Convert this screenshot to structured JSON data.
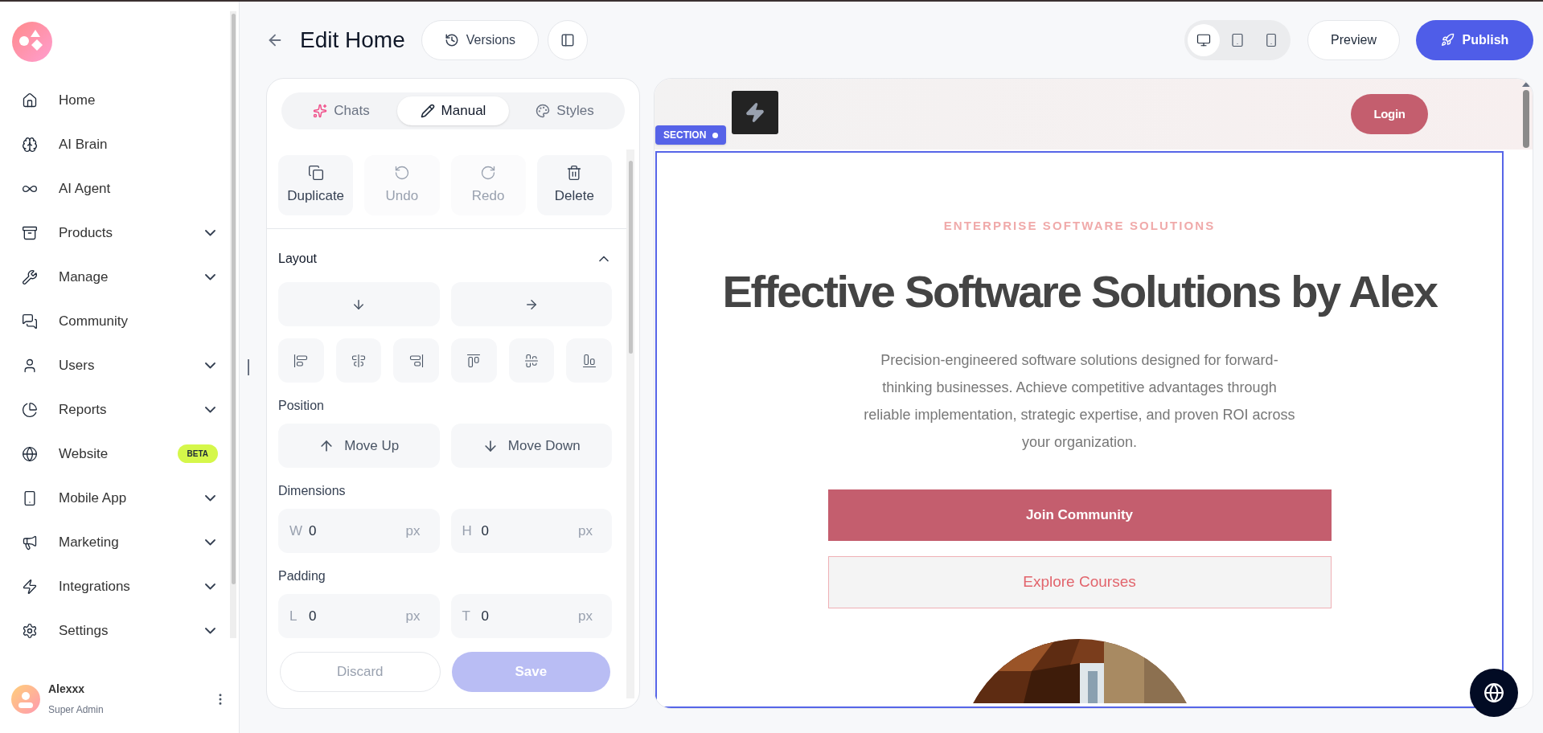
{
  "sidebar": {
    "items": [
      {
        "label": "Home",
        "expandable": false
      },
      {
        "label": "AI Brain",
        "expandable": false
      },
      {
        "label": "AI Agent",
        "expandable": false
      },
      {
        "label": "Products",
        "expandable": true
      },
      {
        "label": "Manage",
        "expandable": true
      },
      {
        "label": "Community",
        "expandable": false
      },
      {
        "label": "Users",
        "expandable": true
      },
      {
        "label": "Reports",
        "expandable": true
      },
      {
        "label": "Website",
        "expandable": false,
        "badge": "BETA"
      },
      {
        "label": "Mobile App",
        "expandable": true
      },
      {
        "label": "Marketing",
        "expandable": true
      },
      {
        "label": "Integrations",
        "expandable": true
      },
      {
        "label": "Settings",
        "expandable": true
      }
    ],
    "user": {
      "name": "Alexxx",
      "role": "Super Admin"
    }
  },
  "header": {
    "title": "Edit Home",
    "versions": "Versions",
    "devices": [
      {
        "selected": true
      },
      {
        "selected": false
      },
      {
        "selected": false
      }
    ],
    "preview": "Preview",
    "publish": "Publish"
  },
  "editor": {
    "tabs": [
      {
        "label": "Chats",
        "selected": false
      },
      {
        "label": "Manual",
        "selected": true
      },
      {
        "label": "Styles",
        "selected": false
      }
    ],
    "actions": [
      {
        "label": "Duplicate",
        "disabled": false
      },
      {
        "label": "Undo",
        "disabled": true
      },
      {
        "label": "Redo",
        "disabled": true
      },
      {
        "label": "Delete",
        "disabled": false
      }
    ],
    "layout": {
      "title": "Layout",
      "expanded": true
    },
    "position": {
      "label": "Position",
      "buttons": [
        "Move Up",
        "Move Down"
      ]
    },
    "dimensions": {
      "label": "Dimensions",
      "fields": [
        {
          "prefix": "W",
          "value": "0",
          "unit": "px"
        },
        {
          "prefix": "H",
          "value": "0",
          "unit": "px"
        }
      ]
    },
    "padding": {
      "label": "Padding",
      "fields": [
        {
          "prefix": "L",
          "value": "0",
          "unit": "px"
        },
        {
          "prefix": "T",
          "value": "0",
          "unit": "px"
        }
      ]
    },
    "discard": "Discard",
    "save": {
      "label": "Save",
      "disabled": true
    }
  },
  "preview": {
    "section_tag": "SECTION",
    "login": "Login",
    "eyebrow": "ENTERPRISE SOFTWARE SOLUTIONS",
    "heading": "Effective Software Solutions by Alex",
    "paragraph": "Precision-engineered software solutions designed for forward-thinking businesses. Achieve competitive advantages through reliable implementation, strategic expertise, and proven ROI across your organization.",
    "primary_cta": "Join Community",
    "secondary_cta": "Explore Courses"
  }
}
